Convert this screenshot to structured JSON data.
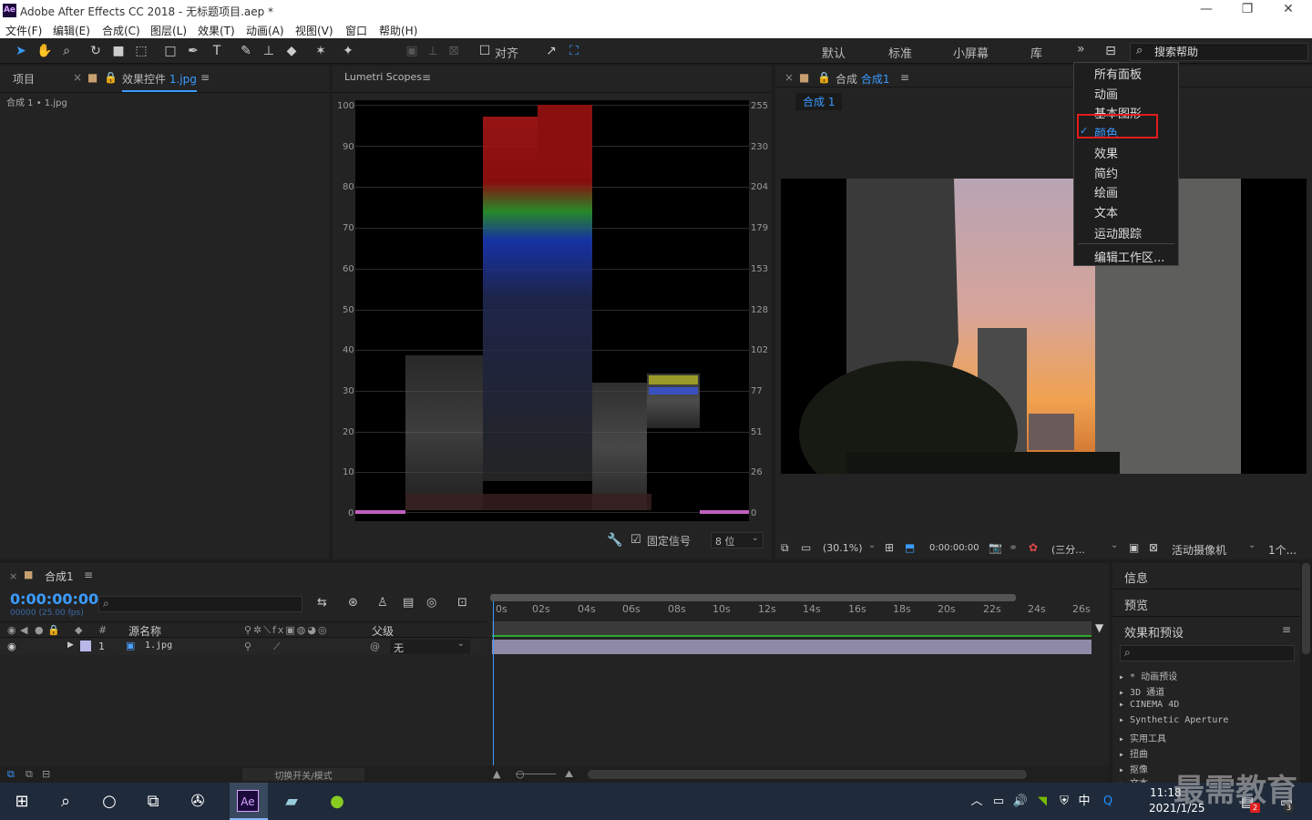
{
  "window": {
    "title": "Adobe After Effects CC 2018 - 无标题项目.aep *",
    "logo": "Ae",
    "minimize_icon": "—",
    "restore_icon": "❐",
    "close_icon": "✕"
  },
  "menu": [
    "文件(F)",
    "编辑(E)",
    "合成(C)",
    "图层(L)",
    "效果(T)",
    "动画(A)",
    "视图(V)",
    "窗口",
    "帮助(H)"
  ],
  "toolbar": {
    "align_label": "对齐",
    "workspaces": [
      "默认",
      "标准",
      "小屏幕",
      "库"
    ],
    "overflow_icon": "»",
    "search_placeholder": "搜索帮助"
  },
  "project_panel": {
    "tab_project": "项目",
    "tab_effects": "效果控件",
    "tab_effects_file": "1.jpg",
    "breadcrumb": "合成 1 • 1.jpg"
  },
  "scopes_panel": {
    "tab": "Lumetri Scopes",
    "left_axis": [
      "100",
      "90",
      "80",
      "70",
      "60",
      "50",
      "40",
      "30",
      "20",
      "10",
      "0"
    ],
    "right_axis": [
      "255",
      "230",
      "204",
      "179",
      "153",
      "128",
      "102",
      "77",
      "51",
      "26",
      "0"
    ],
    "clamp_label": "固定信号",
    "bits": "8 位"
  },
  "comp_panel": {
    "tab_prefix": "合成",
    "tab_name": "合成1",
    "subtab": "合成 1",
    "zoom": "(30.1%)",
    "timecode": "0:00:00:00",
    "resolution": "(三分...",
    "camera": "活动摄像机",
    "views": "1个..."
  },
  "workspace_menu": {
    "items": [
      "所有面板",
      "动画",
      "基本图形",
      "颜色",
      "效果",
      "简约",
      "绘画",
      "文本",
      "运动跟踪",
      "编辑工作区..."
    ],
    "checked": "颜色"
  },
  "timeline": {
    "tab": "合成1",
    "timecode": "0:00:00:00",
    "fps": "00000 (25.00 fps)",
    "col_source": "源名称",
    "col_num": "#",
    "col_parent": "父级",
    "layer_num": "1",
    "layer_name": "1.jpg",
    "parent_value": "无",
    "toggle_label": "切换开关/模式",
    "ruler": [
      "0s",
      "02s",
      "04s",
      "06s",
      "08s",
      "10s",
      "12s",
      "14s",
      "16s",
      "18s",
      "20s",
      "22s",
      "24s",
      "26s"
    ]
  },
  "right_panels": {
    "info": "信息",
    "preview": "预览",
    "effects_presets": "效果和预设",
    "categories": [
      "* 动画预设",
      "3D 通道",
      "CINEMA 4D",
      "Synthetic Aperture",
      "实用工具",
      "扭曲",
      "抠像",
      "文本"
    ]
  },
  "taskbar": {
    "time": "11:18",
    "date": "2021/1/25",
    "ime": "中",
    "ae_label": "Ae",
    "badge1": "2",
    "badge2": "3"
  },
  "watermark": "最需教育"
}
